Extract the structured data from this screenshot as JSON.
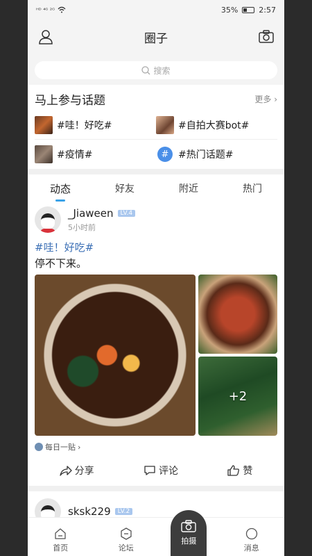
{
  "status": {
    "time": "2:57",
    "battery": "35%",
    "signal_left": "ᴴᴰ ⁴ᴳ ²ᴳ"
  },
  "header": {
    "title": "圈子",
    "icons": [
      "user-icon",
      "camera-icon"
    ]
  },
  "search": {
    "placeholder": "搜索"
  },
  "topics": {
    "heading": "马上参与话题",
    "more": "更多",
    "items": [
      {
        "label": "#哇！好吃#",
        "thumb": "food"
      },
      {
        "label": "#自拍大赛bot#",
        "thumb": "selfie"
      },
      {
        "label": "#疫情#",
        "thumb": "virus"
      },
      {
        "label": "#热门话题#",
        "thumb": "hash"
      }
    ]
  },
  "tabs": [
    "动态",
    "好友",
    "附近",
    "热门"
  ],
  "active_tab": "动态",
  "post": {
    "username": "_Jiaween",
    "level": "LV.4",
    "time": "5小时前",
    "hashtag": "#哇！好吃#",
    "content": "停不下来。",
    "more_photos": "+2",
    "source": "每日一贴",
    "actions": {
      "share": "分享",
      "comment": "评论",
      "like": "赞"
    }
  },
  "post2": {
    "username": "sksk229",
    "level": "LV.2"
  },
  "bottom_nav": {
    "home": "首页",
    "forum": "论坛",
    "shoot": "拍摄",
    "messages": "消息"
  },
  "colors": {
    "accent": "#3aa2e8",
    "hashtag": "#3b6fb5",
    "level_badge": "#a9c7ee",
    "camera_tab": "#3d3d3d"
  }
}
